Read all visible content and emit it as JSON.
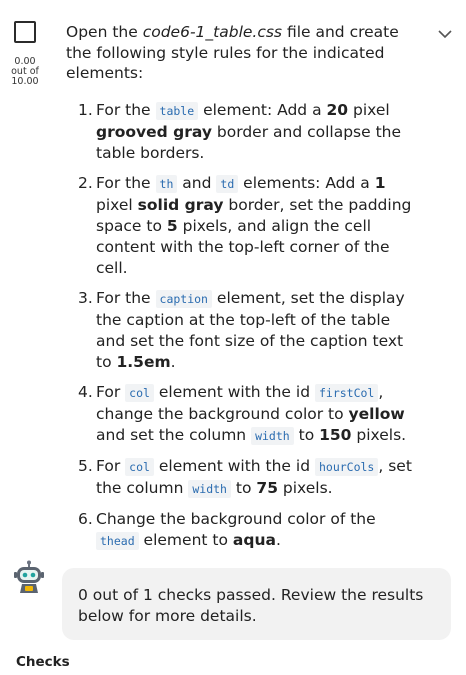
{
  "task": {
    "score_value": "0.00",
    "score_out_of": "out of",
    "score_max": "10.00",
    "intro": {
      "pre": "Open the ",
      "file": "code6-1_table.css",
      "post": " file and create the following style rules for the indicated elements:"
    },
    "steps": [
      {
        "num": "1.",
        "parts": [
          {
            "t": "text",
            "v": "For the "
          },
          {
            "t": "code",
            "v": "table"
          },
          {
            "t": "text",
            "v": " element: Add a "
          },
          {
            "t": "bold",
            "v": "20"
          },
          {
            "t": "text",
            "v": " pixel "
          },
          {
            "t": "bold",
            "v": "grooved gray"
          },
          {
            "t": "text",
            "v": " border and collapse the table borders."
          }
        ]
      },
      {
        "num": "2.",
        "parts": [
          {
            "t": "text",
            "v": "For the "
          },
          {
            "t": "code",
            "v": "th"
          },
          {
            "t": "text",
            "v": " and "
          },
          {
            "t": "code",
            "v": "td"
          },
          {
            "t": "text",
            "v": " elements: Add a "
          },
          {
            "t": "bold",
            "v": "1"
          },
          {
            "t": "text",
            "v": " pixel "
          },
          {
            "t": "bold",
            "v": "solid gray"
          },
          {
            "t": "text",
            "v": " border, set the padding space to "
          },
          {
            "t": "bold",
            "v": "5"
          },
          {
            "t": "text",
            "v": " pixels, and align the cell content with the top-left corner of the cell."
          }
        ]
      },
      {
        "num": "3.",
        "parts": [
          {
            "t": "text",
            "v": "For the "
          },
          {
            "t": "code",
            "v": "caption"
          },
          {
            "t": "text",
            "v": " element, set the display the caption at the top-left of the table and set the font size of the caption text to "
          },
          {
            "t": "bold",
            "v": "1.5em"
          },
          {
            "t": "text",
            "v": "."
          }
        ]
      },
      {
        "num": "4.",
        "parts": [
          {
            "t": "text",
            "v": "For "
          },
          {
            "t": "code",
            "v": "col"
          },
          {
            "t": "text",
            "v": " element with the id "
          },
          {
            "t": "code",
            "v": "firstCol"
          },
          {
            "t": "text",
            "v": ", change the background color to "
          },
          {
            "t": "bold",
            "v": "yellow"
          },
          {
            "t": "text",
            "v": " and set the column "
          },
          {
            "t": "code",
            "v": "width"
          },
          {
            "t": "text",
            "v": " to "
          },
          {
            "t": "bold",
            "v": "150"
          },
          {
            "t": "text",
            "v": " pixels."
          }
        ]
      },
      {
        "num": "5.",
        "parts": [
          {
            "t": "text",
            "v": "For "
          },
          {
            "t": "code",
            "v": "col"
          },
          {
            "t": "text",
            "v": " element with the id "
          },
          {
            "t": "code",
            "v": "hourCols"
          },
          {
            "t": "text",
            "v": ", set the column "
          },
          {
            "t": "code",
            "v": "width"
          },
          {
            "t": "text",
            "v": " to "
          },
          {
            "t": "bold",
            "v": "75"
          },
          {
            "t": "text",
            "v": " pixels."
          }
        ]
      },
      {
        "num": "6.",
        "parts": [
          {
            "t": "text",
            "v": "Change the background color of the "
          },
          {
            "t": "code",
            "v": "thead"
          },
          {
            "t": "text",
            "v": " element to "
          },
          {
            "t": "bold",
            "v": "aqua"
          },
          {
            "t": "text",
            "v": "."
          }
        ]
      }
    ]
  },
  "feedback": {
    "bot_icon": "robot-icon",
    "message": "0 out of 1 checks passed. Review the results below for more details."
  },
  "checks_heading": "Checks",
  "colors": {
    "code_text": "#2b6cb0",
    "code_bg": "#f1f3f5",
    "bubble_bg": "#f2f2f2"
  }
}
